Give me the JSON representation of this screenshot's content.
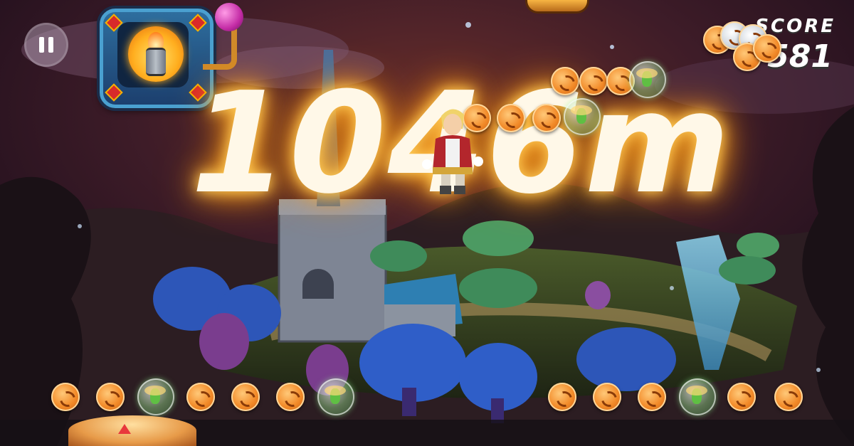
{
  "hud": {
    "pause_icon": "pause-icon",
    "powerup_icon": "fire-barrel-icon",
    "orb_icon": "magenta-orb-icon",
    "score_label": "SCORE",
    "score_value": "581"
  },
  "distance": {
    "text": "1046m"
  },
  "colors": {
    "coin": "#f28a28",
    "distance_glow": "#ffcf5a",
    "sky": "#2a1a2e"
  }
}
